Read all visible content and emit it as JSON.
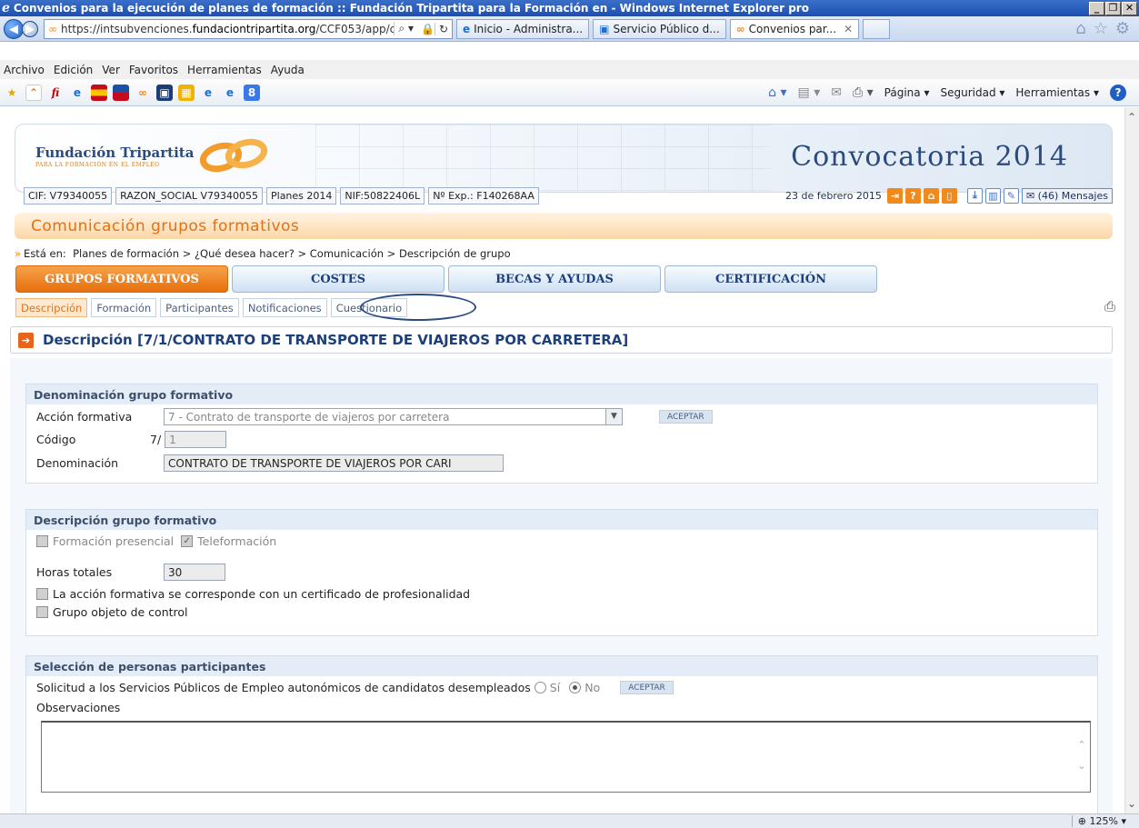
{
  "browser": {
    "window_title": "Convenios para la ejecución de planes de formación :: Fundación Tripartita para la Formación en - Windows Internet Explorer pro",
    "url_prefix": "https://intsubvenciones.",
    "url_domain": "fundaciontripartita.org",
    "url_suffix": "/CCF053/app/comu",
    "tabs": [
      "Inicio - Administra...",
      "Servicio Público d...",
      "Convenios par..."
    ],
    "menu": [
      "Archivo",
      "Edición",
      "Ver",
      "Favoritos",
      "Herramientas",
      "Ayuda"
    ],
    "commands": [
      "Página",
      "Seguridad",
      "Herramientas"
    ],
    "zoom": "125%"
  },
  "banner": {
    "brand_name": "Fundación Tripartita",
    "brand_sub": "PARA LA FORMACIÓN EN EL EMPLEO",
    "convocatoria": "Convocatoria 2014"
  },
  "info": {
    "cif": "CIF: V79340055",
    "razon": "RAZON_SOCIAL V79340055",
    "planes": "Planes 2014",
    "nif": "NIF:50822406L",
    "exp": "Nº Exp.: F140268AA",
    "date": "23 de febrero 2015",
    "messages": "(46) Mensajes"
  },
  "section_title": "Comunicación grupos formativos",
  "breadcrumb": {
    "prefix": "Está en:",
    "path": "Planes de formación > ¿Qué desea hacer? > Comunicación > Descripción de grupo"
  },
  "main_tabs": [
    "GRUPOS FORMATIVOS",
    "COSTES",
    "BECAS Y AYUDAS",
    "CERTIFICACIÓN"
  ],
  "sub_tabs": [
    "Descripción",
    "Formación",
    "Participantes",
    "Notificaciones",
    "Cuestionario"
  ],
  "desc_title": "Descripción [7/1/CONTRATO DE TRANSPORTE DE VIAJEROS POR CARRETERA]",
  "denominacion_panel": {
    "title": "Denominación grupo formativo",
    "accion_label": "Acción formativa",
    "accion_value": "7 - Contrato de transporte de viajeros por carretera",
    "aceptar": "ACEPTAR",
    "codigo_label": "Código",
    "codigo_prefix": "7/",
    "codigo_value": "1",
    "denominacion_label": "Denominación",
    "denominacion_value": "CONTRATO DE TRANSPORTE DE VIAJEROS POR CARI"
  },
  "descripcion_panel": {
    "title": "Descripción grupo formativo",
    "presencial": "Formación presencial",
    "teleformacion": "Teleformación",
    "horas_label": "Horas totales",
    "horas_value": "30",
    "certificado": "La acción formativa se corresponde con un certificado de profesionalidad",
    "control": "Grupo objeto de control"
  },
  "seleccion_panel": {
    "title": "Selección de personas participantes",
    "solicitud": "Solicitud a los Servicios Públicos de Empleo autonómicos de candidatos desempleados",
    "si": "Sí",
    "no": "No",
    "aceptar": "ACEPTAR",
    "observaciones": "Observaciones"
  }
}
